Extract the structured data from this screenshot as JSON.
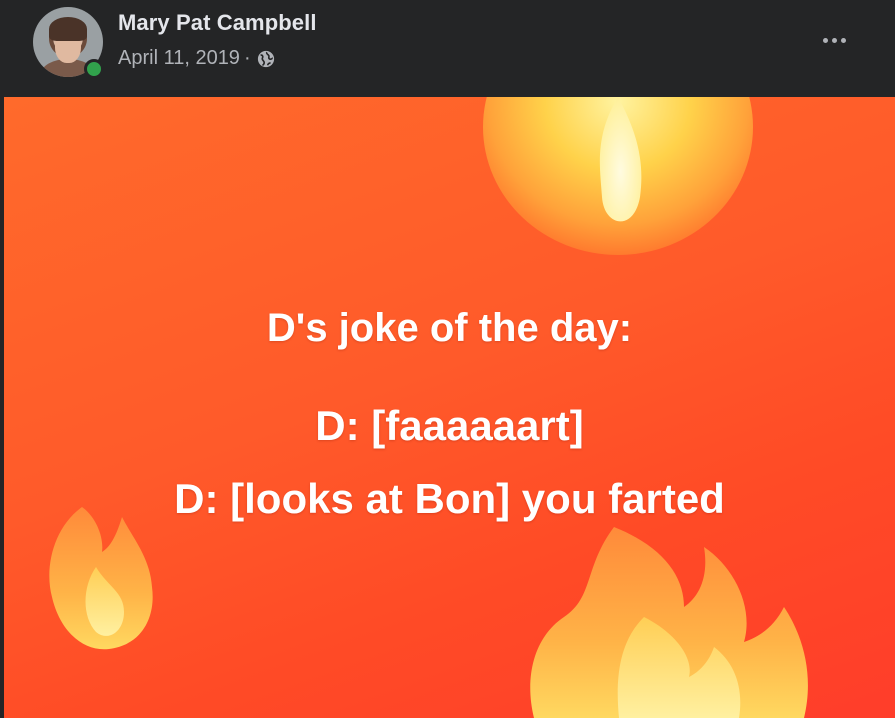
{
  "post": {
    "author_name": "Mary Pat Campbell",
    "date": "April 11, 2019",
    "separator": "·",
    "privacy_icon": "globe-icon",
    "more_icon": "more-options-icon"
  },
  "image": {
    "background_colors": [
      "#ff6a2b",
      "#ff3d2a"
    ],
    "lines": [
      "D's joke of the day:",
      "D: [faaaaaart]",
      "D: [looks at Bon] you farted"
    ]
  },
  "colors": {
    "header_bg": "#242526",
    "name_text": "#e4e6eb",
    "meta_text": "#b0b3b8",
    "online": "#31a24c"
  }
}
